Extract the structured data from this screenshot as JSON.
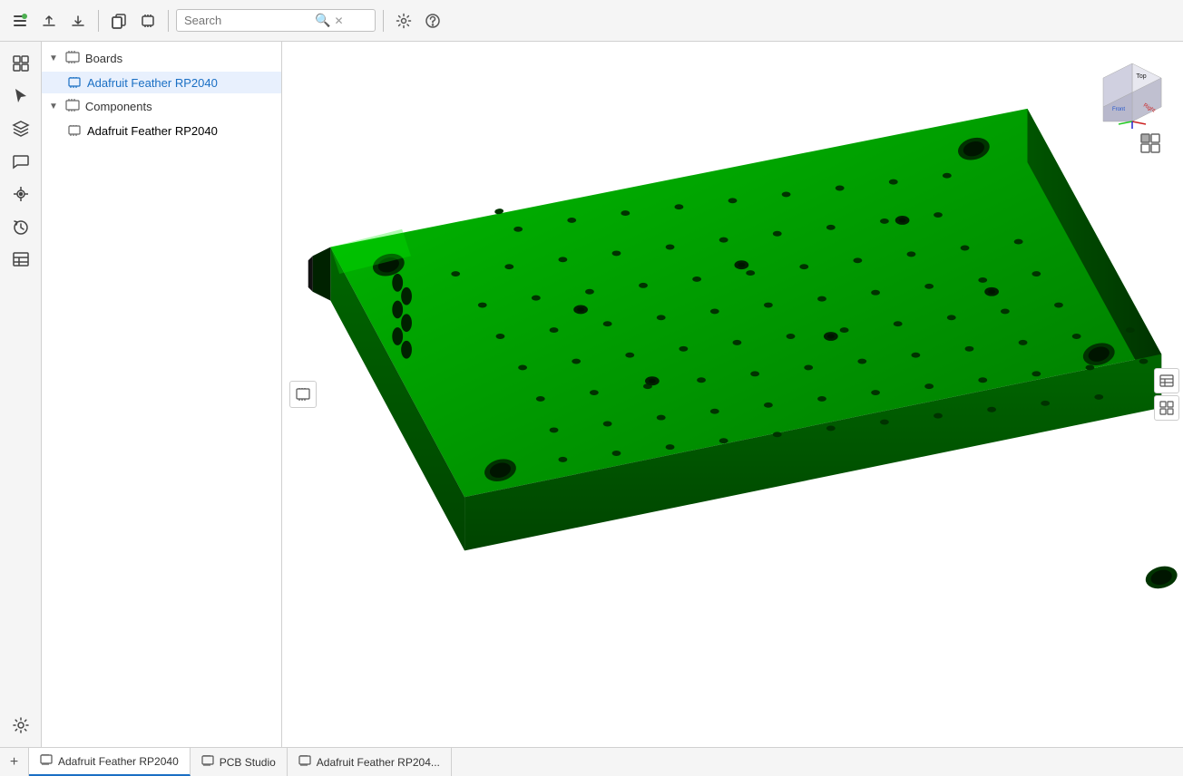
{
  "toolbar": {
    "search_placeholder": "Search",
    "icons": [
      "menu",
      "upload",
      "download",
      "copy",
      "circuit"
    ]
  },
  "sidebar": {
    "boards_label": "Boards",
    "boards_item": "Adafruit Feather RP2040",
    "components_label": "Components",
    "components_item": "Adafruit Feather RP2040"
  },
  "viewport": {
    "nav_cube": {
      "top": "Top",
      "front": "Front",
      "right": "Right"
    }
  },
  "tabs": [
    {
      "label": "Adafruit Feather RP2040",
      "icon": "board",
      "active": true
    },
    {
      "label": "PCB Studio",
      "icon": "studio",
      "active": false
    },
    {
      "label": "Adafruit Feather RP204...",
      "icon": "board",
      "active": false
    }
  ],
  "colors": {
    "pcb_green": "#008000",
    "pcb_bright_green": "#00c000",
    "pcb_dark_green": "#005000",
    "accent_blue": "#1a6fc4"
  }
}
